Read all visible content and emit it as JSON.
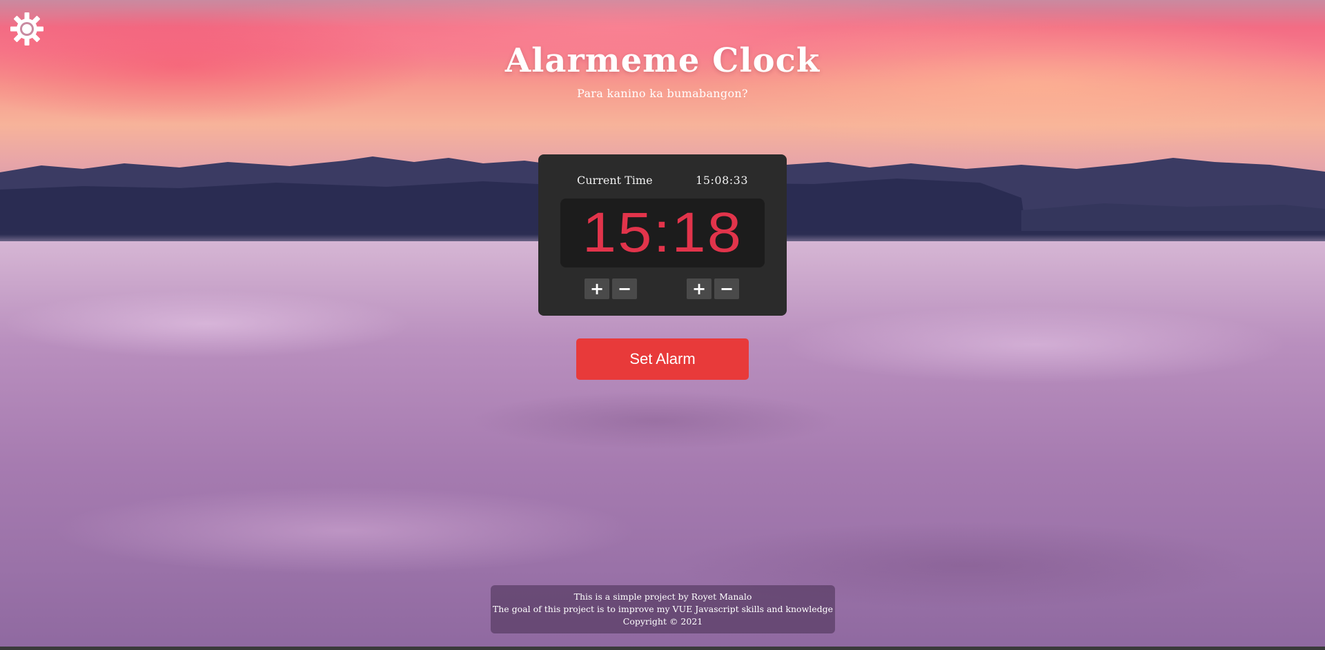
{
  "app": {
    "title": "Alarmeme Clock",
    "subtitle": "Para kanino ka bumabangon?"
  },
  "settings": {
    "icon": "gear-icon"
  },
  "clock": {
    "current_label": "Current Time",
    "current_time": "15:08:33",
    "alarm_time": "15:18",
    "alarm_color": "#e2344b",
    "hour_increment_label": "+",
    "hour_decrement_label": "−",
    "minute_increment_label": "+",
    "minute_decrement_label": "−"
  },
  "actions": {
    "set_alarm_label": "Set Alarm",
    "set_alarm_color": "#e83a3a"
  },
  "footer": {
    "line1": "This is a simple project by Royet Manalo",
    "line2": "The goal of this project is to improve my VUE Javascript skills and knowledge",
    "line3": "Copyright © 2021"
  }
}
